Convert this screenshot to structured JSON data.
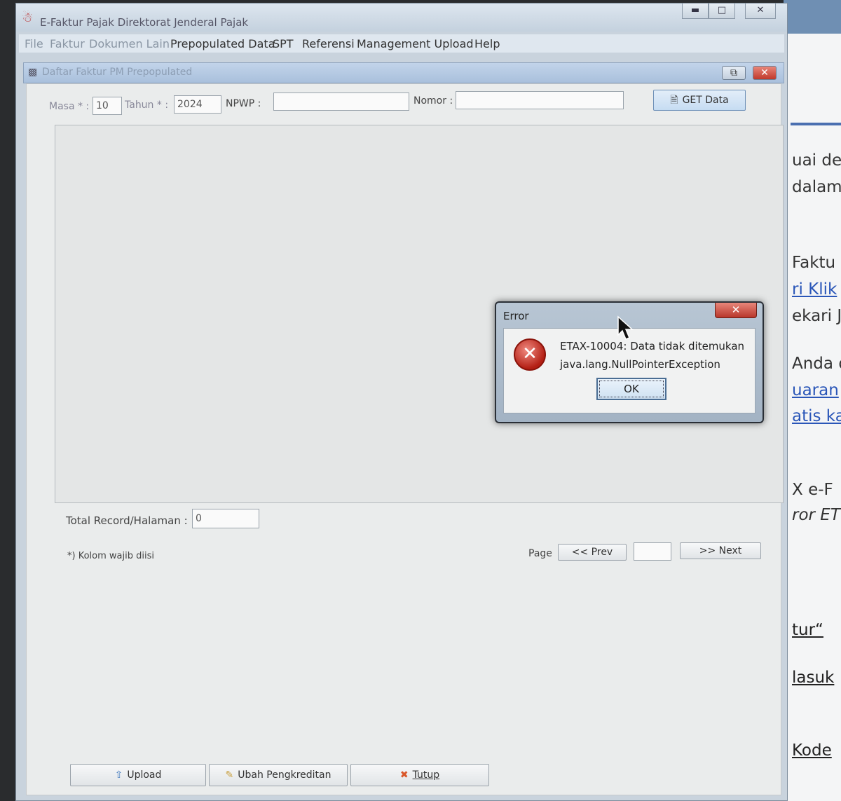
{
  "background_page": {
    "fragments": [
      {
        "text": "uai de",
        "style": "normal",
        "top": 0
      },
      {
        "text": "dalam",
        "style": "normal"
      },
      {
        "text": "Faktu",
        "style": "normal"
      },
      {
        "text": "ri Klik",
        "style": "link"
      },
      {
        "text": "ekari J",
        "style": "normal"
      },
      {
        "text": "Anda d",
        "style": "normal"
      },
      {
        "text": "uaran",
        "style": "link"
      },
      {
        "text": "atis ka",
        "style": "link"
      },
      {
        "text": "X e-F",
        "style": "normal"
      },
      {
        "text": "ror ET",
        "style": "italic"
      },
      {
        "text": "tur“",
        "style": "dark"
      },
      {
        "text": "lasuk",
        "style": "dark"
      },
      {
        "text": "Kode",
        "style": "dark"
      }
    ]
  },
  "window": {
    "title": "E-Faktur Pajak Direktorat Jenderal Pajak",
    "minimize_icon": "minimize-icon",
    "maximize_icon": "maximize-icon",
    "close_icon": "close-icon"
  },
  "menu": [
    "File",
    "Faktur",
    "Dokumen Lain",
    "Prepopulated Data",
    "SPT",
    "Referensi",
    "Management Upload",
    "Help"
  ],
  "internal_frame": {
    "title": "Daftar Faktur PM Prepopulated"
  },
  "filters": {
    "masa_label": "Masa * :",
    "masa_value": "10",
    "tahun_label": "Tahun * :",
    "tahun_value": "2024",
    "npwp_label": "NPWP :",
    "npwp_value": "",
    "nomor_label": "Nomor :",
    "nomor_value": "",
    "get_data_label": "GET Data"
  },
  "footer": {
    "total_label": "Total Record/Halaman :",
    "total_value": "0",
    "note": "*) Kolom wajib diisi",
    "page_label": "Page",
    "prev_label": "<< Prev",
    "page_value": "",
    "next_label": ">> Next"
  },
  "actions": {
    "upload_label": "Upload",
    "ubah_label": "Ubah Pengkreditan",
    "tutup_label": "Tutup"
  },
  "dialog": {
    "title": "Error",
    "line1": "ETAX-10004: Data tidak ditemukan",
    "line2": "java.lang.NullPointerException",
    "ok_label": "OK"
  }
}
